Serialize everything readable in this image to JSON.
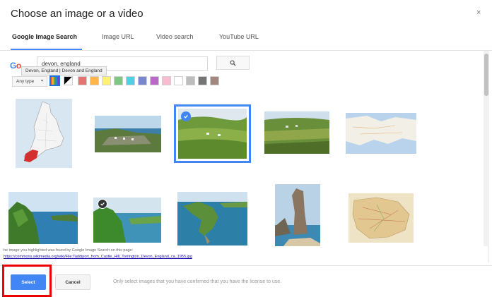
{
  "dialog": {
    "title": "Choose an image or a video",
    "close_glyph": "×"
  },
  "tabs": [
    {
      "label": "Google Image Search",
      "active": true
    },
    {
      "label": "Image URL",
      "active": false
    },
    {
      "label": "Video search",
      "active": false
    },
    {
      "label": "YouTube URL",
      "active": false
    }
  ],
  "search": {
    "logo_text": "Go",
    "query": "devon, england",
    "button_icon": "search-icon",
    "tooltip": "Devon, England | Devon and England"
  },
  "filters": {
    "type_label": "Any type",
    "colors": [
      "multicolor",
      "black-white",
      "#e57373",
      "#ffb74d",
      "#fff176",
      "#81c784",
      "#4dd0e1",
      "#7986cb",
      "#ba68c8",
      "#f8bbd0",
      "#ffffff",
      "#bdbdbd",
      "#757575",
      "#a1887f"
    ]
  },
  "results": [
    {
      "subject": "england-map",
      "selected": false
    },
    {
      "subject": "coastal-town",
      "selected": false
    },
    {
      "subject": "green-hills",
      "selected": true,
      "mark": "blue"
    },
    {
      "subject": "village-fields",
      "selected": false
    },
    {
      "subject": "coast-map",
      "selected": false
    },
    {
      "subject": "sea-cliffs",
      "selected": false
    },
    {
      "subject": "green-headland",
      "selected": false,
      "mark": "dark"
    },
    {
      "subject": "aerial-peninsula",
      "selected": false
    },
    {
      "subject": "rock-stack",
      "selected": false
    },
    {
      "subject": "old-map",
      "selected": false
    }
  ],
  "source": {
    "found_text": "he image you highlighted was found by Google Image Search on this page:",
    "url": "https://commons.wikimedia.org/wiki/File:Taddiport_from_Castle_Hill_Torrington_Devon_England_ca_1955.jpg"
  },
  "footer": {
    "select_label": "Select",
    "cancel_label": "Cancel",
    "license_note": "Only select images that you have confirmed that you have the license to use."
  },
  "colors": {
    "accent": "#4285f4",
    "highlight": "#e00000"
  }
}
